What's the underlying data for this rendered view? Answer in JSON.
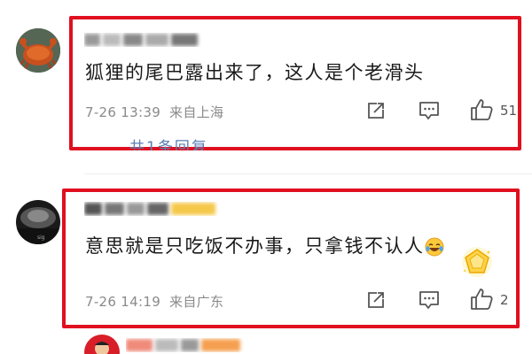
{
  "comments": [
    {
      "username": "",
      "text": "狐狸的尾巴露出来了，这人是个老滑头",
      "time": "7-26 13:39",
      "location": "来自上海",
      "like_count": "51",
      "replies_label": "共1条回复"
    },
    {
      "username": "",
      "text": "意思就是只吃饭不办事，只拿钱不认人",
      "time": "7-26 14:19",
      "location": "来自广东",
      "like_count": "2"
    }
  ],
  "icons": {
    "share": "share-icon",
    "comment": "comment-icon",
    "like": "thumbs-up-icon",
    "emoji": "laughing-crying-emoji",
    "badge": "vip-diamond-badge-icon"
  },
  "colors": {
    "highlight_box": "#e01020",
    "replies_link": "#5a7fb5",
    "meta_text": "#8a8a8a"
  }
}
